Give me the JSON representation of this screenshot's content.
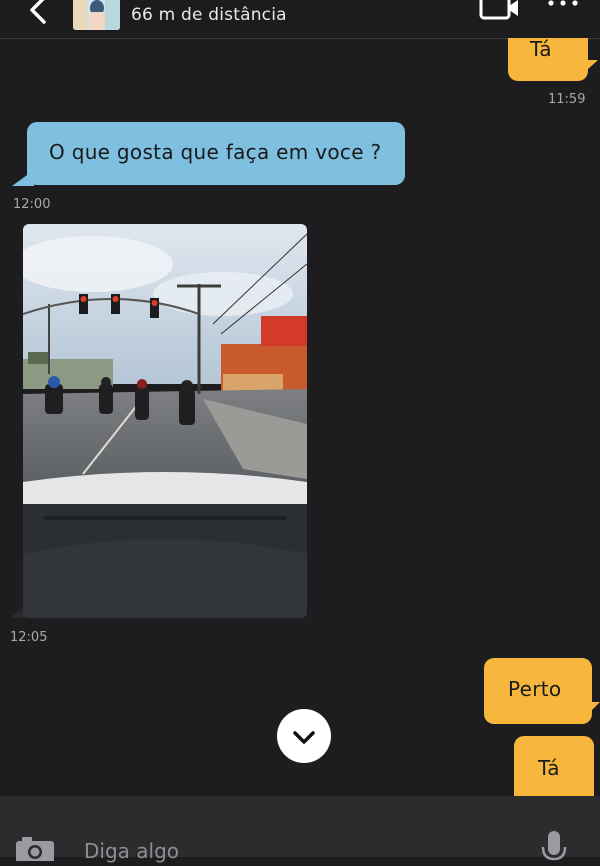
{
  "header": {
    "distance": "66 m de distância",
    "back_icon": "chevron-left-icon",
    "video_icon": "video-call-icon",
    "more_icon": "more-dots-icon"
  },
  "messages": [
    {
      "direction": "out",
      "text": "Tá",
      "time": "11:59"
    },
    {
      "direction": "in",
      "text": "O que gosta que faça  em voce ?",
      "time": "12:00"
    },
    {
      "direction": "in",
      "type": "photo",
      "time": "12:05"
    },
    {
      "direction": "out",
      "text": "Perto"
    },
    {
      "direction": "out",
      "text": "Tá"
    }
  ],
  "composer": {
    "placeholder": "Diga algo",
    "camera_icon": "camera-icon",
    "mic_icon": "microphone-icon"
  },
  "colors": {
    "background": "#1d1d1f",
    "outgoing_bubble": "#f6b73c",
    "incoming_bubble": "#7fbfe0"
  }
}
